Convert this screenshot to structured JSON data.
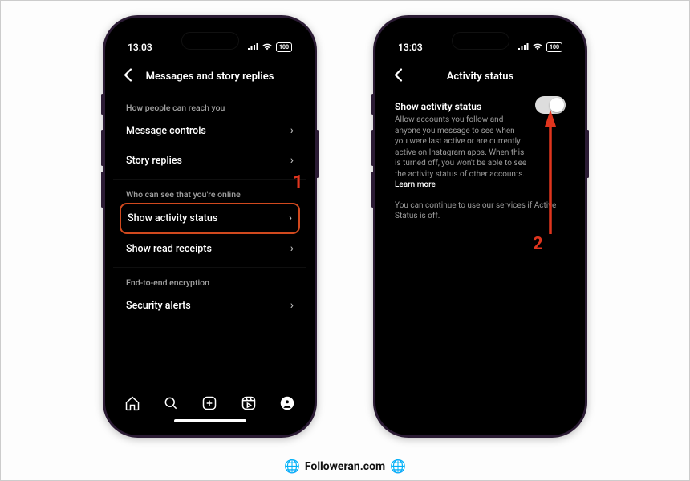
{
  "statusbar": {
    "time": "13:03",
    "battery": "100"
  },
  "phone1": {
    "title": "Messages and story replies",
    "sections": {
      "reach_h": "How people can reach you",
      "reach": [
        {
          "label": "Message controls"
        },
        {
          "label": "Story replies"
        }
      ],
      "online_h": "Who can see that you're online",
      "online": [
        {
          "label": "Show activity status",
          "highlight": true
        },
        {
          "label": "Show read receipts"
        }
      ],
      "enc_h": "End-to-end encryption",
      "enc": [
        {
          "label": "Security alerts"
        }
      ]
    }
  },
  "phone2": {
    "title": "Activity status",
    "heading": "Show activity status",
    "desc1": "Allow accounts you follow and anyone you message to see when you were last active or are currently active on Instagram apps. When this is turned off, you won't be able to see the activity status of other accounts. ",
    "learn_more": "Learn more",
    "desc2": "You can continue to use our services if Active Status is off."
  },
  "annotations": {
    "step1": "1",
    "step2": "2"
  },
  "footer": {
    "text": "Followeran.com"
  }
}
